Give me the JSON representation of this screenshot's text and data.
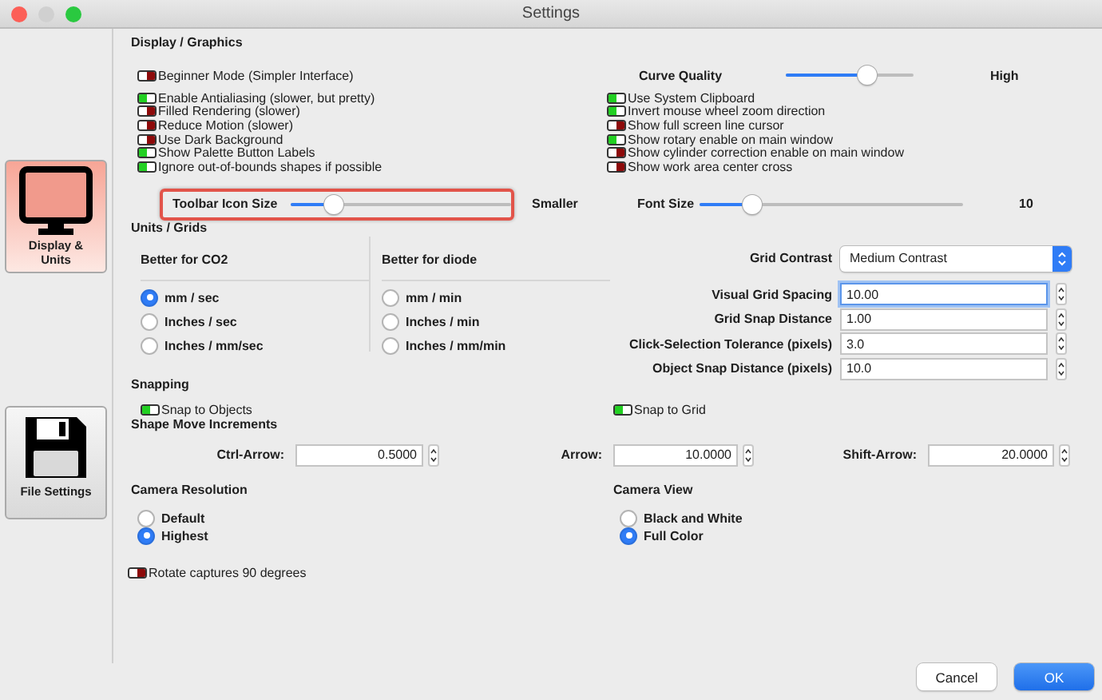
{
  "window": {
    "title": "Settings"
  },
  "sidebar": {
    "items": [
      {
        "label": "Display & Units",
        "kind": "monitor",
        "selected": true
      },
      {
        "label": "File Settings",
        "kind": "floppy",
        "selected": false
      }
    ]
  },
  "display_graphics": {
    "title": "Display / Graphics",
    "left_toggles": [
      {
        "label": "Beginner Mode (Simpler Interface)",
        "on": false
      },
      {
        "label": "Enable Antialiasing (slower, but pretty)",
        "on": true
      },
      {
        "label": "Filled Rendering (slower)",
        "on": false
      },
      {
        "label": "Reduce Motion (slower)",
        "on": false
      },
      {
        "label": "Use Dark Background",
        "on": false
      },
      {
        "label": "Show Palette Button Labels",
        "on": true
      },
      {
        "label": "Ignore out-of-bounds shapes if possible",
        "on": true
      }
    ],
    "curve_quality": {
      "label": "Curve Quality",
      "level": 0.64,
      "value": "High"
    },
    "right_toggles": [
      {
        "label": "Use System Clipboard",
        "on": true
      },
      {
        "label": "Invert mouse wheel zoom direction",
        "on": true
      },
      {
        "label": "Show full screen line cursor",
        "on": false
      },
      {
        "label": "Show rotary enable on main window",
        "on": true
      },
      {
        "label": "Show cylinder correction enable on main window",
        "on": false
      },
      {
        "label": "Show work area center cross",
        "on": false
      }
    ],
    "toolbar_icon_size": {
      "label": "Toolbar Icon Size",
      "level": 0.2,
      "value": "Smaller",
      "highlighted": true
    },
    "font_size": {
      "label": "Font Size",
      "level": 0.2,
      "value": "10"
    }
  },
  "units_grids": {
    "title": "Units / Grids",
    "co2": {
      "title": "Better for CO2",
      "options": [
        {
          "label": "mm / sec",
          "selected": true
        },
        {
          "label": "Inches / sec",
          "selected": false
        },
        {
          "label": "Inches / mm/sec",
          "selected": false
        }
      ]
    },
    "diode": {
      "title": "Better for diode",
      "options": [
        {
          "label": "mm / min",
          "selected": false
        },
        {
          "label": "Inches / min",
          "selected": false
        },
        {
          "label": "Inches / mm/min",
          "selected": false
        }
      ]
    },
    "grid_contrast": {
      "label": "Grid Contrast",
      "value": "Medium Contrast"
    },
    "fields": [
      {
        "label": "Visual Grid Spacing",
        "value": "10.00",
        "focused": true
      },
      {
        "label": "Grid Snap Distance",
        "value": "1.00",
        "focused": false
      },
      {
        "label": "Click-Selection Tolerance (pixels)",
        "value": "3.0",
        "focused": false
      },
      {
        "label": "Object Snap Distance (pixels)",
        "value": "10.0",
        "focused": false
      }
    ]
  },
  "snapping": {
    "title": "Snapping",
    "snap_to_objects": {
      "label": "Snap to Objects",
      "on": true
    },
    "snap_to_grid": {
      "label": "Snap to Grid",
      "on": true
    },
    "increments_title": "Shape Move Increments",
    "increments": [
      {
        "label": "Ctrl-Arrow:",
        "value": "0.5000"
      },
      {
        "label": "Arrow:",
        "value": "10.0000"
      },
      {
        "label": "Shift-Arrow:",
        "value": "20.0000"
      }
    ]
  },
  "camera_resolution": {
    "title": "Camera Resolution",
    "options": [
      {
        "label": "Default",
        "selected": false
      },
      {
        "label": "Highest",
        "selected": true
      }
    ]
  },
  "camera_view": {
    "title": "Camera View",
    "options": [
      {
        "label": "Black and White",
        "selected": false
      },
      {
        "label": "Full Color",
        "selected": true
      }
    ]
  },
  "rotate_captures": {
    "label": "Rotate captures 90 degrees",
    "on": false
  },
  "buttons": [
    {
      "label": "Cancel",
      "kind": "default"
    },
    {
      "label": "OK",
      "kind": "primary"
    }
  ]
}
